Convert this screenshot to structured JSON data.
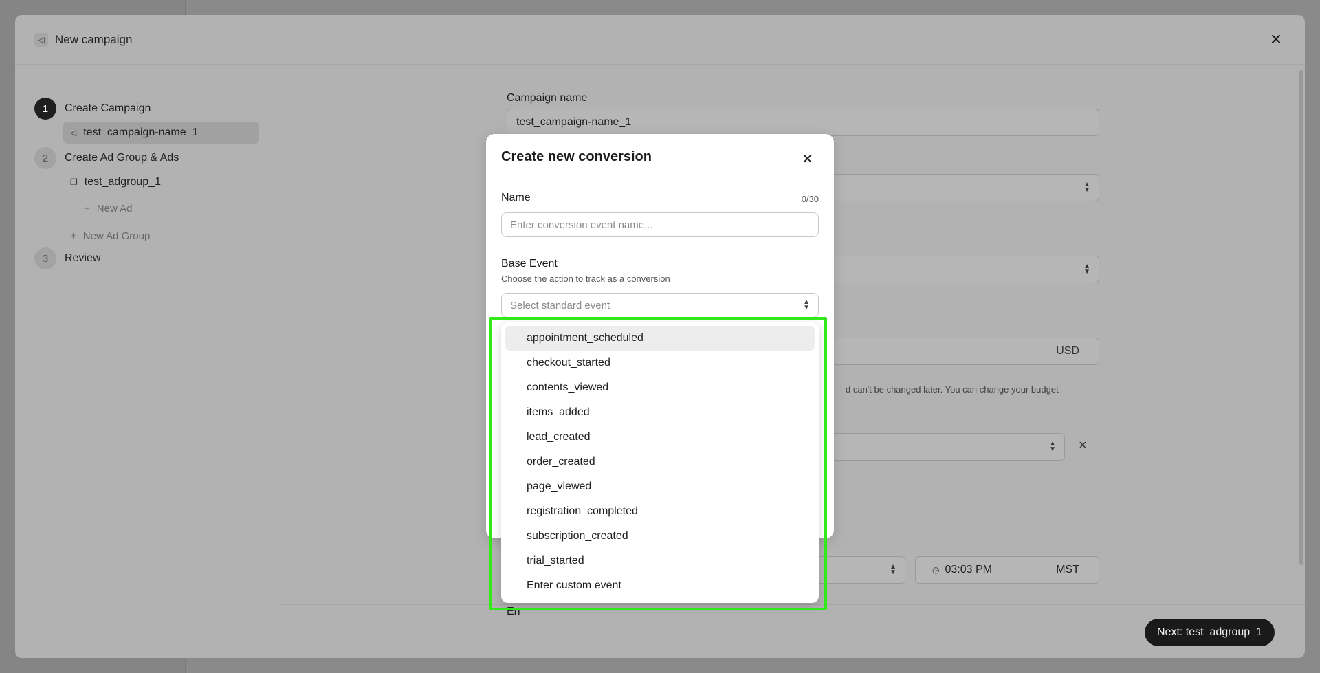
{
  "campaign_modal": {
    "title": "New campaign",
    "icon": "megaphone-icon",
    "steps": [
      {
        "number": "1",
        "label": "Create Campaign"
      },
      {
        "number": "2",
        "label": "Create Ad Group & Ads"
      },
      {
        "number": "3",
        "label": "Review"
      }
    ],
    "campaign_item": "test_campaign-name_1",
    "adgroup_item": "test_adgroup_1",
    "new_ad": "New Ad",
    "new_ad_group": "New Ad Group",
    "campaign_name_label": "Campaign name",
    "campaign_name_value": "test_campaign-name_1",
    "currency": "USD",
    "budget_helper": "d can't be changed later. You can change your budget",
    "time_value": "03:03 PM",
    "timezone": "MST",
    "partial_label": "En",
    "next_button": "Next: test_adgroup_1"
  },
  "conversion_modal": {
    "title": "Create new conversion",
    "name_label": "Name",
    "name_count": "0/30",
    "name_placeholder": "Enter conversion event name...",
    "base_event_label": "Base Event",
    "base_event_help": "Choose the action to track as a conversion",
    "select_placeholder": "Select standard event"
  },
  "dropdown": {
    "options": [
      "appointment_scheduled",
      "checkout_started",
      "contents_viewed",
      "items_added",
      "lead_created",
      "order_created",
      "page_viewed",
      "registration_completed",
      "subscription_created",
      "trial_started",
      "Enter custom event"
    ],
    "hovered_index": 0
  },
  "colors": {
    "highlight": "#33e91a",
    "primary_dark": "#1a1a1a"
  }
}
